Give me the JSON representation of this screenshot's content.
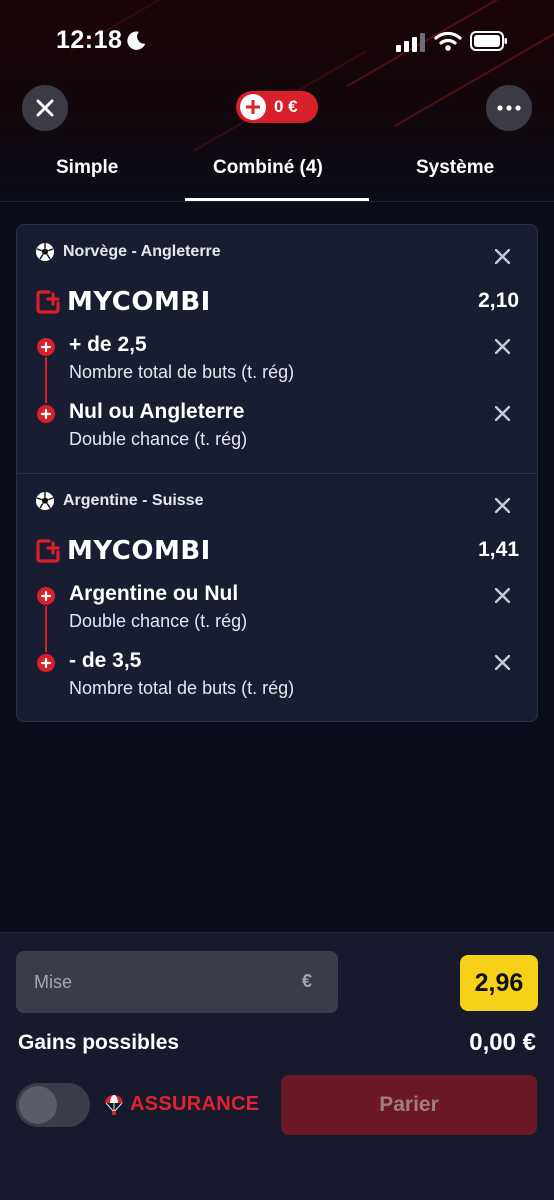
{
  "status_bar": {
    "time": "12:18"
  },
  "header": {
    "balance": "0 €"
  },
  "tabs": [
    {
      "label": "Simple"
    },
    {
      "label": "Combiné (4)"
    },
    {
      "label": "Système"
    }
  ],
  "bets": [
    {
      "match": "Norvège - Angleterre",
      "combi_label": "MYCOMBI",
      "odds": "2,10",
      "selections": [
        {
          "title": "+ de 2,5",
          "market": "Nombre total de buts (t. rég)"
        },
        {
          "title": "Nul ou Angleterre",
          "market": "Double chance (t. rég)"
        }
      ]
    },
    {
      "match": "Argentine - Suisse",
      "combi_label": "MYCOMBI",
      "odds": "1,41",
      "selections": [
        {
          "title": "Argentine ou Nul",
          "market": "Double chance (t. rég)"
        },
        {
          "title": "- de 3,5",
          "market": "Nombre total de buts (t. rég)"
        }
      ]
    }
  ],
  "footer": {
    "stake_placeholder": "Mise",
    "currency": "€",
    "total_odds": "2,96",
    "gains_label": "Gains possibles",
    "gains_value": "0,00 €",
    "assurance_label": "ASSURANCE",
    "bet_button": "Parier",
    "insurance_enabled": false
  },
  "colors": {
    "brand_red": "#d81f2a",
    "odds_yellow": "#f7d117",
    "card_bg": "#191d31",
    "page_bg": "#0b0d1a"
  }
}
